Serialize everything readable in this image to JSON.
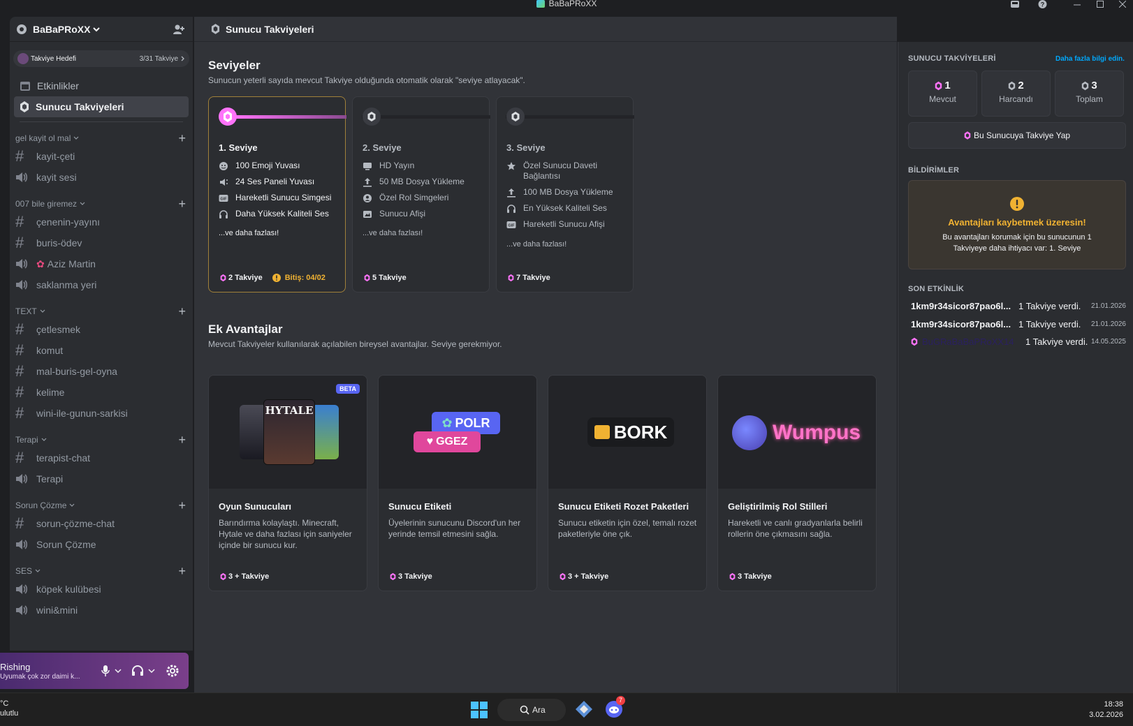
{
  "window": {
    "title": "BaBaPRoXX"
  },
  "sidebar": {
    "server_name": "BaBaPRoXX",
    "boost_goal": {
      "label": "Takviye Hedefi",
      "count": "3/31 Takviye"
    },
    "nav": [
      {
        "label": "Etkinlikler"
      },
      {
        "label": "Sunucu Takviyeleri"
      }
    ],
    "categories": [
      {
        "name": "gel kayit ol mal",
        "channels": [
          {
            "type": "text",
            "name": "kayit-çeti"
          },
          {
            "type": "voice",
            "name": "kayit sesi"
          }
        ]
      },
      {
        "name": "007 bile giremez",
        "channels": [
          {
            "type": "text",
            "name": "çenenin-yayını"
          },
          {
            "type": "text",
            "name": "buris-ödev"
          },
          {
            "type": "voice",
            "name": "Aziz Martin"
          },
          {
            "type": "voice",
            "name": "saklanma yeri"
          }
        ]
      },
      {
        "name": "TEXT",
        "channels": [
          {
            "type": "text",
            "name": "çetlesmek"
          },
          {
            "type": "text",
            "name": "komut"
          },
          {
            "type": "text",
            "name": "mal-buris-gel-oyna"
          },
          {
            "type": "text",
            "name": "kelime"
          },
          {
            "type": "text",
            "name": "wini-ile-gunun-sarkisi"
          }
        ]
      },
      {
        "name": "Terapi",
        "channels": [
          {
            "type": "text",
            "name": "terapist-chat"
          },
          {
            "type": "voice",
            "name": "Terapi"
          }
        ]
      },
      {
        "name": "Sorun Çözme",
        "channels": [
          {
            "type": "text",
            "name": "sorun-çözme-chat"
          },
          {
            "type": "voice",
            "name": "Sorun Çözme"
          }
        ]
      },
      {
        "name": "SES",
        "channels": [
          {
            "type": "voice",
            "name": "köpek kulübesi"
          },
          {
            "type": "voice",
            "name": "wini&mini"
          }
        ]
      }
    ],
    "user": {
      "name": "Rishing",
      "status": "Uyumak çok zor daimi k..."
    }
  },
  "main": {
    "header": "Sunucu Takviyeleri",
    "levels": {
      "title": "Seviyeler",
      "subtitle": "Sunucun yeterli sayıda mevcut Takviye olduğunda otomatik olarak \"seviye atlayacak\".",
      "tiers": [
        {
          "name": "1. Seviye",
          "perks": [
            "100 Emoji Yuvası",
            "24 Ses Paneli Yuvası",
            "Hareketli Sunucu Simgesi",
            "Daha Yüksek Kaliteli Ses"
          ],
          "icons": [
            "emoji-icon",
            "soundboard-icon",
            "gif-icon",
            "headphones-icon"
          ],
          "more": "...ve daha fazlası!",
          "boosts": "2 Takviye",
          "expiry": "Bitiş: 04/02"
        },
        {
          "name": "2. Seviye",
          "perks": [
            "HD Yayın",
            "50 MB Dosya Yükleme",
            "Özel Rol Simgeleri",
            "Sunucu Afişi"
          ],
          "icons": [
            "screen-icon",
            "upload-icon",
            "role-icon",
            "banner-icon"
          ],
          "more": "...ve daha fazlası!",
          "boosts": "5 Takviye"
        },
        {
          "name": "3. Seviye",
          "perks": [
            "Özel Sunucu Daveti Bağlantısı",
            "100 MB Dosya Yükleme",
            "En Yüksek Kaliteli Ses",
            "Hareketli Sunucu Afişi"
          ],
          "icons": [
            "star-icon",
            "upload-icon",
            "headphones-icon",
            "gif-icon"
          ],
          "more": "...ve daha fazlası!",
          "boosts": "7 Takviye"
        }
      ]
    },
    "extras": {
      "title": "Ek Avantajlar",
      "subtitle": "Mevcut Takviyeler kullanılarak açılabilen bireysel avantajlar. Seviye gerekmiyor.",
      "cards": [
        {
          "title": "Oyun Sunucuları",
          "desc": "Barındırma kolaylaştı. Minecraft, Hytale ve daha fazlası için saniyeler içinde bir sunucu kur.",
          "cost": "3 + Takviye",
          "badge": "BETA",
          "art": "HYTALE"
        },
        {
          "title": "Sunucu Etiketi",
          "desc": "Üyelerinin sunucunu Discord'un her yerinde temsil etmesini sağla.",
          "cost": "3 Takviye",
          "art_a": "POLR",
          "art_b": "GGEZ"
        },
        {
          "title": "Sunucu Etiketi Rozet Paketleri",
          "desc": "Sunucu etiketin için özel, temalı rozet paketleriyle öne çık.",
          "cost": "3 + Takviye",
          "art": "BORK"
        },
        {
          "title": "Geliştirilmiş Rol Stilleri",
          "desc": "Hareketli ve canlı gradyanlarla belirli rollerin öne çıkmasını sağla.",
          "cost": "3 Takviye",
          "art": "Wumpus"
        }
      ]
    }
  },
  "right": {
    "title": "SUNUCU TAKVİYELERİ",
    "learn_more": "Daha fazla bilgi edin.",
    "stats": [
      {
        "n": "1",
        "l": "Mevcut"
      },
      {
        "n": "2",
        "l": "Harcandı"
      },
      {
        "n": "3",
        "l": "Toplam"
      }
    ],
    "boost_button": "Bu Sunucuya Takviye Yap",
    "notifications_title": "BİLDİRİMLER",
    "notif_title": "Avantajları kaybetmek üzeresin!",
    "notif_body": "Bu avantajları korumak için bu sunucunun 1 Takviyeye daha ihtiyacı var: 1. Seviye",
    "activity_title": "SON ETKİNLİK",
    "activity": [
      {
        "who": "1km9r34sicor87pao6l...",
        "what": "1 Takviye verdi.",
        "date": "21.01.2026"
      },
      {
        "who": "1km9r34sicor87pao6l...",
        "what": "1 Takviye verdi.",
        "date": "21.01.2026"
      },
      {
        "who": "BuGRaBaBaPRoXX14",
        "what": "1 Takviye verdi.",
        "date": "14.05.2025"
      }
    ]
  },
  "taskbar": {
    "weather_top": "°C",
    "weather_bottom": "ulutlu",
    "search": "Ara",
    "discord_badge": "7",
    "time": "18:38",
    "date": "3.02.2026"
  },
  "colors": {
    "accent": "#ff73fa",
    "warning": "#f0b232",
    "bg": "#313338",
    "sidebar": "#2b2d31"
  }
}
